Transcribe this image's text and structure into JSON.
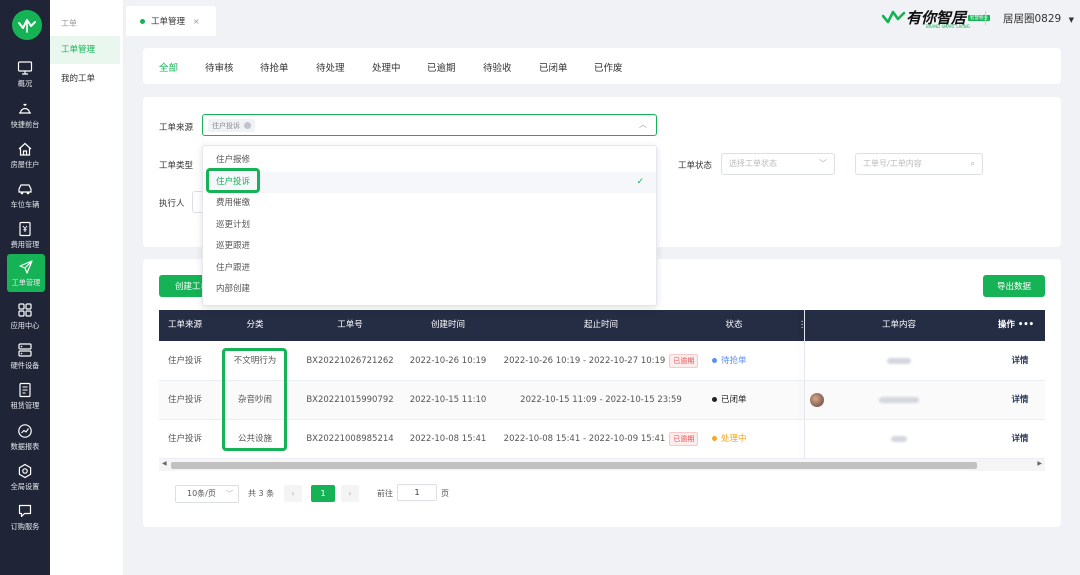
{
  "nav": {
    "logo_text": "有你智居",
    "items": [
      {
        "label": "概况",
        "icon": "monitor-icon"
      },
      {
        "label": "快捷前台",
        "icon": "bell-desk-icon"
      },
      {
        "label": "房屋住户",
        "icon": "house-icon"
      },
      {
        "label": "车位车辆",
        "icon": "car-icon"
      },
      {
        "label": "费用管理",
        "icon": "yen-card-icon"
      },
      {
        "label": "工单管理",
        "icon": "send-icon"
      },
      {
        "label": "应用中心",
        "icon": "grid-icon"
      },
      {
        "label": "硬件设备",
        "icon": "server-icon"
      },
      {
        "label": "租赁管理",
        "icon": "document-icon"
      },
      {
        "label": "数据报表",
        "icon": "chart-icon"
      },
      {
        "label": "全局设置",
        "icon": "gear-icon"
      },
      {
        "label": "订购服务",
        "icon": "message-icon"
      }
    ]
  },
  "subnav": {
    "title": "工单",
    "items": [
      {
        "label": "工单管理"
      },
      {
        "label": "我的工单"
      }
    ]
  },
  "topbar": {
    "tab_label": "工单管理",
    "brand": "有你智居",
    "brand_tag": "智慧物业",
    "brand_sub": "BRAND SMART LIVING",
    "user": "居居圈0829"
  },
  "status_tabs": [
    "全部",
    "待审核",
    "待抢单",
    "待处理",
    "处理中",
    "已逾期",
    "待验收",
    "已闭单",
    "已作废"
  ],
  "filters": {
    "source_label": "工单来源",
    "source_chip": "住户投诉",
    "type_label": "工单类型",
    "status_label": "工单状态",
    "status_placeholder": "选择工单状态",
    "search_placeholder": "工单号/工单内容",
    "executor_label": "执行人"
  },
  "dropdown": [
    "住户报修",
    "住户投诉",
    "费用催缴",
    "巡更计划",
    "巡更跟进",
    "住户跟进",
    "内部创建"
  ],
  "buttons": {
    "create": "创建工单",
    "export": "导出数据"
  },
  "table": {
    "headers": [
      "工单来源",
      "分类",
      "工单号",
      "创建时间",
      "起止时间",
      "状态",
      "工单内容",
      "操作 •••"
    ],
    "rows": [
      {
        "source": "住户投诉",
        "category": "不文明行为",
        "no": "BX20221026721262",
        "created": "2022-10-26 10:19",
        "range": "2022-10-26 10:19 - 2022-10-27 10:19",
        "overdue": "已逾期",
        "status": "待抢单",
        "status_color": "#5b8ff9",
        "action": "详情"
      },
      {
        "source": "住户投诉",
        "category": "杂音吵闹",
        "no": "BX20221015990792",
        "created": "2022-10-15 11:10",
        "range": "2022-10-15 11:09 - 2022-10-15 23:59",
        "overdue": "",
        "status": "已闭单",
        "status_color": "#222222",
        "action": "详情"
      },
      {
        "source": "住户投诉",
        "category": "公共设施",
        "no": "BX20221008985214",
        "created": "2022-10-08 15:41",
        "range": "2022-10-08 15:41 - 2022-10-09 15:41",
        "overdue": "已逾期",
        "status": "处理中",
        "status_color": "#f5a623",
        "action": "详情"
      }
    ]
  },
  "pagination": {
    "page_size": "10条/页",
    "total": "共 3 条",
    "current": "1",
    "goto_label": "前往",
    "goto_value": "1",
    "page_unit": "页"
  },
  "colors": {
    "accent": "#16b356",
    "nav_bg": "#1f2536",
    "table_head": "#252d45",
    "danger": "#e45656"
  }
}
